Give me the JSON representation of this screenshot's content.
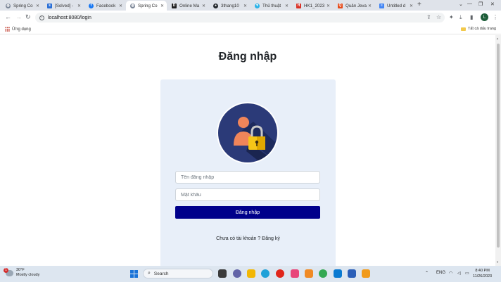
{
  "browser": {
    "tabs": [
      {
        "label": "Spring Co",
        "favicon": "globe-icon",
        "active": false
      },
      {
        "label": "[Solved] -",
        "favicon": "dev-icon",
        "active": false
      },
      {
        "label": "Facebook",
        "favicon": "facebook-icon",
        "active": false
      },
      {
        "label": "Spring Co",
        "favicon": "globe-icon",
        "active": true
      },
      {
        "label": "Online Ma",
        "favicon": "online-icon",
        "active": false
      },
      {
        "label": "3thang10",
        "favicon": "github-icon",
        "active": false
      },
      {
        "label": "Thủ thuật",
        "favicon": "funnel-icon",
        "active": false
      },
      {
        "label": "HK1_2023",
        "favicon": "doc-icon",
        "active": false
      },
      {
        "label": "Quản Jeva",
        "favicon": "sheet-icon",
        "active": false
      },
      {
        "label": "Untitled d",
        "favicon": "docs-icon",
        "active": false
      }
    ],
    "new_tab": "+",
    "url": "localhost:8080/login",
    "profile_initial": "L",
    "bookmarks": {
      "apps_label": "Ứng dụng",
      "all_bookmarks_label": "Tất cả dấu trang"
    }
  },
  "page": {
    "title": "Đăng nhập",
    "username_placeholder": "Tên đăng nhập",
    "password_placeholder": "Mật khẩu",
    "submit_label": "Đăng nhập",
    "no_account_text": "Chưa có tài khoản ?",
    "register_link": "Đăng ký",
    "colors": {
      "card_bg": "#e8eff9",
      "submit_bg": "#00008b",
      "avatar_circle": "#2b3a78",
      "person_head": "#f0855a",
      "lock_body": "#f5c518"
    }
  },
  "taskbar": {
    "weather_temp": "30°F",
    "weather_desc": "Mostly cloudy",
    "weather_badge": "1",
    "search_label": "Search",
    "language": "ENG",
    "time": "8:40 PM",
    "date": "11/26/2023"
  }
}
